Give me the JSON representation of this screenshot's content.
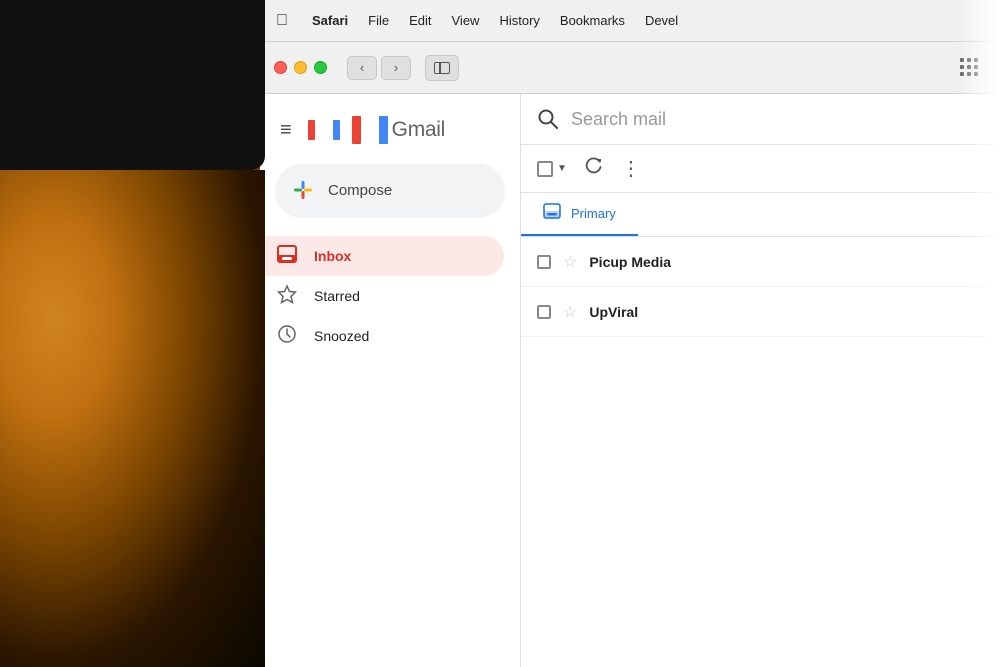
{
  "background": {
    "color": "#1a1a1a"
  },
  "mac_menubar": {
    "apple_label": "",
    "items": [
      {
        "label": "Safari",
        "bold": true
      },
      {
        "label": "File",
        "bold": false
      },
      {
        "label": "Edit",
        "bold": false
      },
      {
        "label": "View",
        "bold": false
      },
      {
        "label": "History",
        "bold": false
      },
      {
        "label": "Bookmarks",
        "bold": false
      },
      {
        "label": "Devel",
        "bold": false
      }
    ]
  },
  "browser": {
    "back_label": "‹",
    "forward_label": "›",
    "grid_tooltip": "Tab overview"
  },
  "gmail": {
    "hamburger_label": "≡",
    "logo_color_m": "#EA4335",
    "wordmark": "Gmail",
    "search_placeholder": "Search mail",
    "compose_label": "Compose",
    "nav_items": [
      {
        "label": "Inbox",
        "active": true,
        "icon": "inbox"
      },
      {
        "label": "Starred",
        "active": false,
        "icon": "star"
      },
      {
        "label": "Snoozed",
        "active": false,
        "icon": "clock"
      }
    ],
    "tabs": [
      {
        "label": "Primary",
        "active": false,
        "icon": "inbox"
      }
    ],
    "email_rows": [
      {
        "sender": "Picup Media",
        "star": false
      },
      {
        "sender": "UpViral",
        "star": false
      }
    ]
  }
}
